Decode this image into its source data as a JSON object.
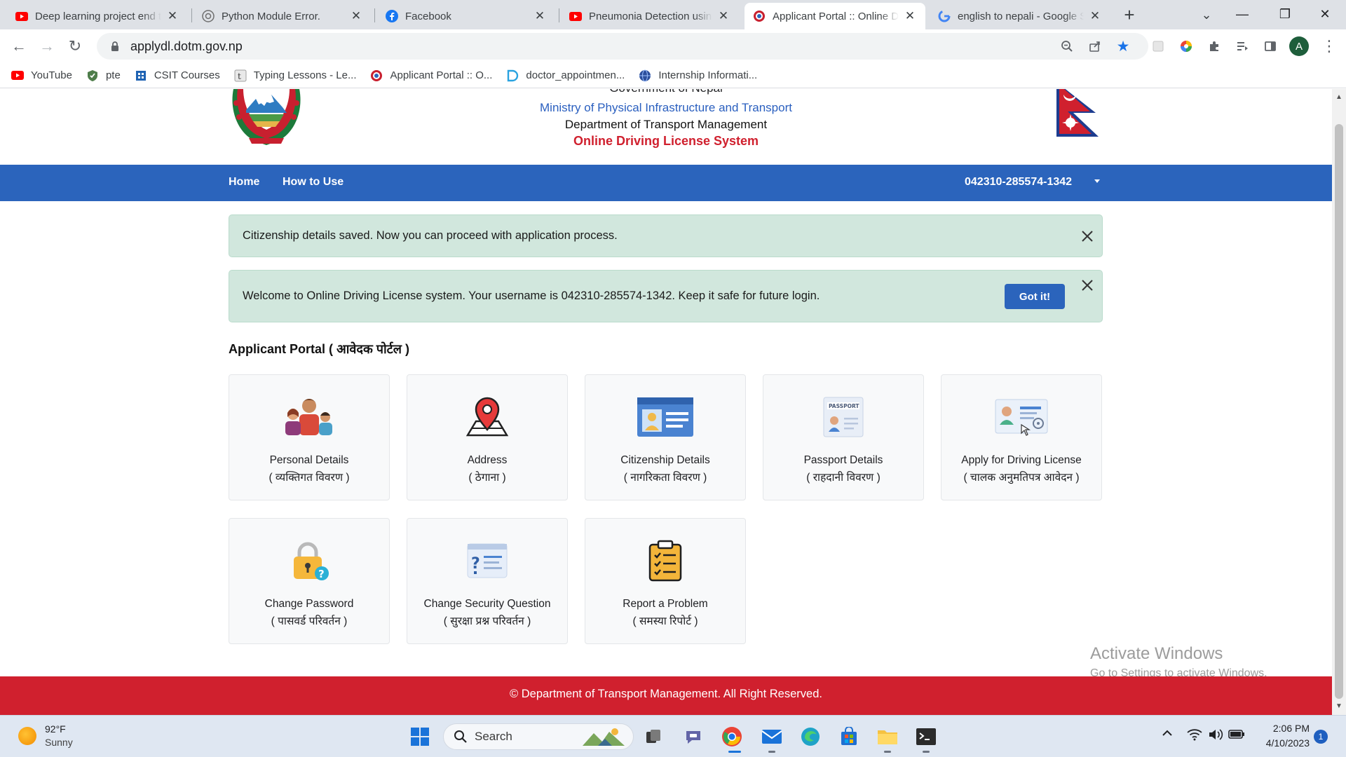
{
  "browser": {
    "tabs": [
      {
        "title": "Deep learning project end to end",
        "favicon": "youtube-icon"
      },
      {
        "title": "Python Module Error.",
        "favicon": "chatgpt-icon"
      },
      {
        "title": "Facebook",
        "favicon": "facebook-icon"
      },
      {
        "title": "Pneumonia Detection using",
        "favicon": "youtube-icon"
      },
      {
        "title": "Applicant Portal :: Online Driving",
        "favicon": "nepal-emblem-icon"
      },
      {
        "title": "english to nepali - Google Search",
        "favicon": "google-icon"
      }
    ],
    "active_tab": 4,
    "url": "applydl.dotm.gov.np",
    "profile_initial": "A",
    "bookmarks": [
      {
        "label": "YouTube",
        "icon": "youtube-icon"
      },
      {
        "label": "pte",
        "icon": "pte-icon"
      },
      {
        "label": "CSIT Courses",
        "icon": "building-icon"
      },
      {
        "label": "Typing Lessons - Le...",
        "icon": "typing-icon"
      },
      {
        "label": "Applicant Portal :: O...",
        "icon": "nepal-emblem-icon"
      },
      {
        "label": "doctor_appointmen...",
        "icon": "d-icon"
      },
      {
        "label": "Internship Informati...",
        "icon": "globe-icon"
      }
    ]
  },
  "site": {
    "header": {
      "gov": "Government of Nepal",
      "ministry": "Ministry of Physical Infrastructure and Transport",
      "department": "Department of Transport Management",
      "system": "Online Driving License System"
    },
    "nav": {
      "home": "Home",
      "how_to_use": "How to Use",
      "username": "042310-285574-1342"
    },
    "alerts": {
      "saved": "Citizenship details saved. Now you can proceed with application process.",
      "welcome": "Welcome to Online Driving License system. Your username is 042310-285574-1342. Keep it safe for future login.",
      "got_it": "Got it!"
    },
    "portal_title": "Applicant Portal ( आवेदक पोर्टल )",
    "cards": [
      {
        "en": "Personal Details",
        "np": "( व्यक्तिगत विवरण )",
        "icon": "family-icon"
      },
      {
        "en": "Address",
        "np": "( ठेगाना )",
        "icon": "location-pin-icon"
      },
      {
        "en": "Citizenship Details",
        "np": "( नागरिकता विवरण )",
        "icon": "id-card-icon"
      },
      {
        "en": "Passport Details",
        "np": "( राहदानी विवरण )",
        "icon": "passport-icon"
      },
      {
        "en": "Apply for Driving License",
        "np": "( चालक अनुमतिपत्र आवेदन )",
        "icon": "driving-license-icon"
      },
      {
        "en": "Change Password",
        "np": "( पासवर्ड परिवर्तन )",
        "icon": "padlock-icon"
      },
      {
        "en": "Change Security Question",
        "np": "( सुरक्षा प्रश्न परिवर्तन )",
        "icon": "security-question-icon"
      },
      {
        "en": "Report a Problem",
        "np": "( समस्या रिपोर्ट )",
        "icon": "clipboard-icon"
      }
    ],
    "footer": "© Department of Transport Management. All Right Reserved."
  },
  "watermark": {
    "line1": "Activate Windows",
    "line2": "Go to Settings to activate Windows."
  },
  "taskbar": {
    "weather_temp": "92°F",
    "weather_desc": "Sunny",
    "search_label": "Search",
    "time": "2:06 PM",
    "date": "4/10/2023",
    "notifications": "1"
  },
  "colors": {
    "nav_blue": "#2b64bc",
    "footer_red": "#d0202e",
    "alert_green": "#d1e7dd"
  }
}
